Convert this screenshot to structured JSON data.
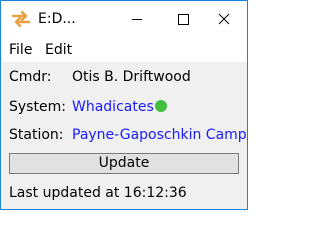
{
  "window": {
    "title": "E:D...",
    "icon": "edmc-arrows-icon",
    "controls": [
      "minimize-icon",
      "maximize-icon",
      "close-icon"
    ]
  },
  "menu": {
    "file": "File",
    "edit": "Edit"
  },
  "fields": {
    "cmdr_label": "Cmdr:",
    "cmdr_value": "Otis B. Driftwood",
    "system_label": "System:",
    "system_value": "Whadicates",
    "station_label": "Station:",
    "station_value": "Payne-Gaposchkin Camp"
  },
  "update_button": "Update",
  "status": "Last updated at 16:12:36",
  "colors": {
    "link": "#1a1aff",
    "status_dot": "#40c040",
    "app_icon": "#e8a040",
    "window_border": "#1883d7"
  }
}
